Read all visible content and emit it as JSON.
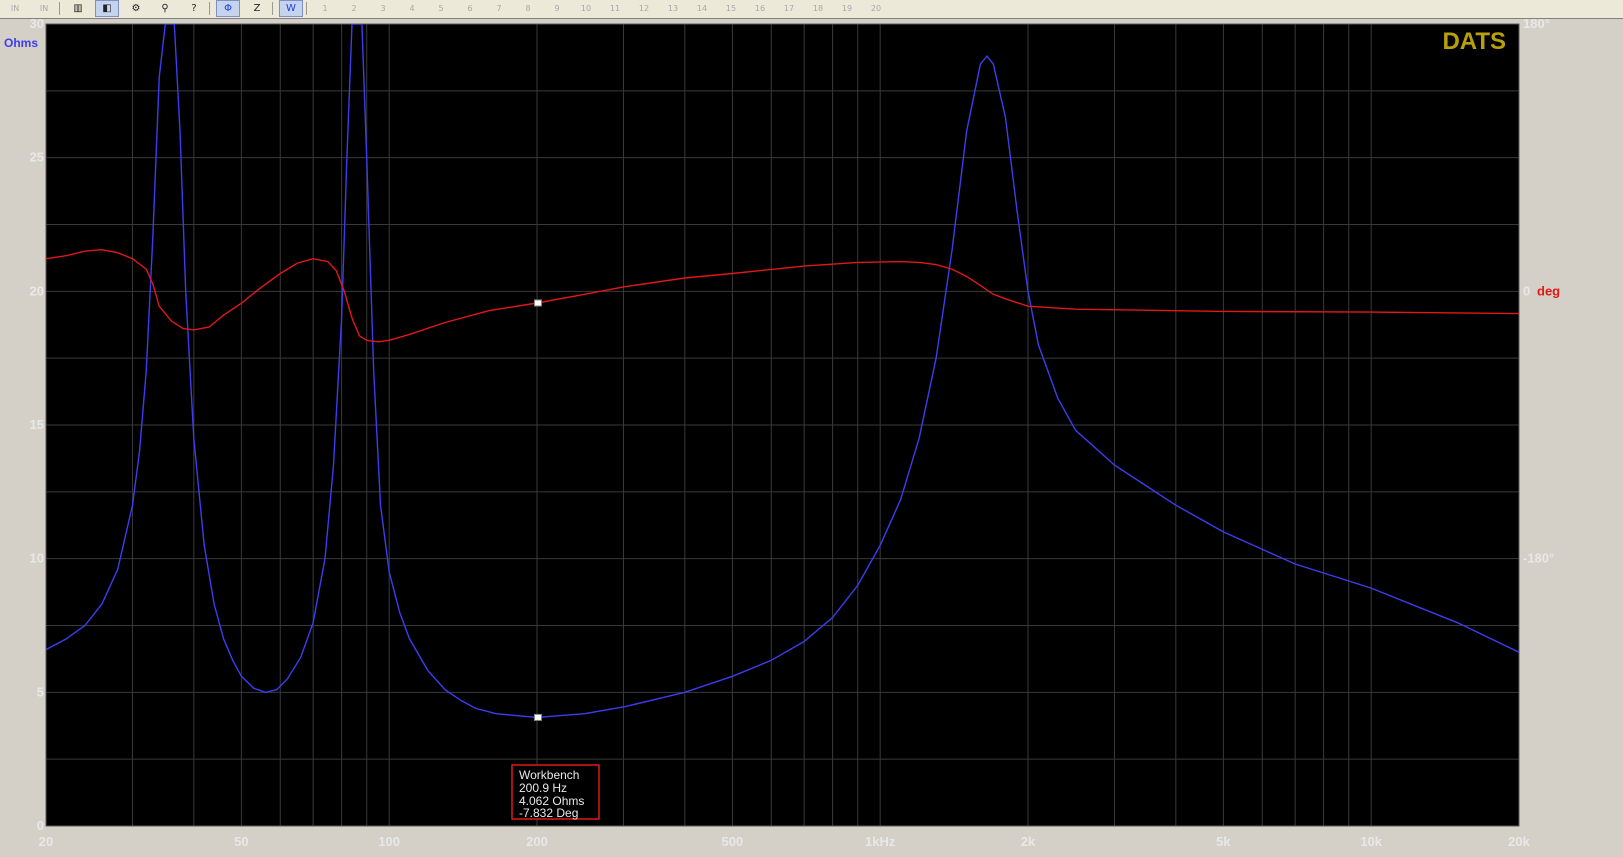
{
  "toolbar": {
    "buttons": [
      {
        "name": "mode-in-button",
        "glyph": "IN",
        "dim": true
      },
      {
        "name": "mode-out-button",
        "glyph": "IN",
        "dim": true
      },
      {
        "name": "measure-bars-button",
        "glyph": "▥"
      },
      {
        "name": "impedance-view-button",
        "glyph": "◧",
        "selected": true
      },
      {
        "name": "sweep-settings-button",
        "glyph": "⚙"
      },
      {
        "name": "probe-button",
        "glyph": "⚲"
      },
      {
        "name": "cursor-help-button",
        "glyph": "?"
      },
      {
        "name": "phase-button",
        "glyph": "Φ",
        "blue": true,
        "selected": true
      },
      {
        "name": "impedance-z-button",
        "glyph": "Z"
      },
      {
        "name": "workbench-button",
        "glyph": "W",
        "blue": true,
        "selected": true
      },
      {
        "name": "memory-1-button",
        "glyph": "1",
        "dim": true
      },
      {
        "name": "memory-2-button",
        "glyph": "2",
        "dim": true
      },
      {
        "name": "memory-3-button",
        "glyph": "3",
        "dim": true
      },
      {
        "name": "memory-4-button",
        "glyph": "4",
        "dim": true
      },
      {
        "name": "memory-5-button",
        "glyph": "5",
        "dim": true
      },
      {
        "name": "memory-6-button",
        "glyph": "6",
        "dim": true
      },
      {
        "name": "memory-7-button",
        "glyph": "7",
        "dim": true
      },
      {
        "name": "memory-8-button",
        "glyph": "8",
        "dim": true
      },
      {
        "name": "memory-9-button",
        "glyph": "9",
        "dim": true
      },
      {
        "name": "memory-10-button",
        "glyph": "10",
        "dim": true
      },
      {
        "name": "memory-11-button",
        "glyph": "11",
        "dim": true
      },
      {
        "name": "memory-12-button",
        "glyph": "12",
        "dim": true
      },
      {
        "name": "memory-13-button",
        "glyph": "13",
        "dim": true
      },
      {
        "name": "memory-14-button",
        "glyph": "14",
        "dim": true
      },
      {
        "name": "memory-15-button",
        "glyph": "15",
        "dim": true
      },
      {
        "name": "memory-16-button",
        "glyph": "16",
        "dim": true
      },
      {
        "name": "memory-17-button",
        "glyph": "17",
        "dim": true
      },
      {
        "name": "memory-18-button",
        "glyph": "18",
        "dim": true
      },
      {
        "name": "memory-19-button",
        "glyph": "19",
        "dim": true
      },
      {
        "name": "memory-20-button",
        "glyph": "20",
        "dim": true
      }
    ]
  },
  "chart_data": {
    "type": "line",
    "brand": "DATS",
    "y_unit_label": "Ohms",
    "x_scale": "log",
    "xlim": [
      20,
      20000
    ],
    "x_ticks": [
      {
        "v": 20,
        "label": "20"
      },
      {
        "v": 50,
        "label": "50"
      },
      {
        "v": 100,
        "label": "100"
      },
      {
        "v": 200,
        "label": "200"
      },
      {
        "v": 500,
        "label": "500"
      },
      {
        "v": 1000,
        "label": "1kHz"
      },
      {
        "v": 2000,
        "label": "2k"
      },
      {
        "v": 5000,
        "label": "5k"
      },
      {
        "v": 10000,
        "label": "10k"
      },
      {
        "v": 20000,
        "label": "20k"
      }
    ],
    "ylim": [
      0,
      30
    ],
    "y_ticks": [
      {
        "v": 0,
        "label": "0"
      },
      {
        "v": 5,
        "label": "5"
      },
      {
        "v": 10,
        "label": "10"
      },
      {
        "v": 15,
        "label": "15"
      },
      {
        "v": 20,
        "label": "20"
      },
      {
        "v": 25,
        "label": "25"
      },
      {
        "v": 30,
        "label": "30"
      }
    ],
    "y2lim": [
      -360,
      180
    ],
    "y2_ticks": [
      {
        "v": 180,
        "label": "180°"
      },
      {
        "v": 0,
        "label": "0",
        "unit": "deg"
      },
      {
        "v": -180,
        "label": "-180°"
      }
    ],
    "grid": true,
    "colors": {
      "background": "#000000",
      "grid": "#3a3a3a",
      "impedance": "#3d3df0",
      "phase": "#e01818",
      "brand": "#b8a00a",
      "marker_box": "#e01818"
    },
    "series": [
      {
        "key": "impedance",
        "axis": "left",
        "points": [
          [
            20,
            6.6
          ],
          [
            22,
            7.0
          ],
          [
            24,
            7.5
          ],
          [
            26,
            8.3
          ],
          [
            28,
            9.6
          ],
          [
            30,
            12.0
          ],
          [
            31,
            14.0
          ],
          [
            32,
            17.0
          ],
          [
            33,
            22.0
          ],
          [
            34,
            28.0
          ],
          [
            35,
            30.0
          ],
          [
            36.5,
            30.0
          ],
          [
            37.5,
            26.0
          ],
          [
            38.5,
            20.0
          ],
          [
            40,
            14.5
          ],
          [
            42,
            10.5
          ],
          [
            44,
            8.3
          ],
          [
            46,
            7.0
          ],
          [
            48,
            6.2
          ],
          [
            50,
            5.6
          ],
          [
            53,
            5.15
          ],
          [
            56,
            5.0
          ],
          [
            59,
            5.1
          ],
          [
            62,
            5.5
          ],
          [
            66,
            6.3
          ],
          [
            70,
            7.6
          ],
          [
            74,
            10.0
          ],
          [
            77,
            13.5
          ],
          [
            80,
            19.0
          ],
          [
            82,
            25.0
          ],
          [
            84,
            30.0
          ],
          [
            88,
            30.0
          ],
          [
            90,
            25.0
          ],
          [
            93,
            17.0
          ],
          [
            96,
            12.0
          ],
          [
            100,
            9.5
          ],
          [
            105,
            8.0
          ],
          [
            110,
            7.0
          ],
          [
            120,
            5.8
          ],
          [
            130,
            5.1
          ],
          [
            140,
            4.7
          ],
          [
            150,
            4.4
          ],
          [
            165,
            4.2
          ],
          [
            200,
            4.062
          ],
          [
            250,
            4.2
          ],
          [
            300,
            4.45
          ],
          [
            400,
            5.0
          ],
          [
            500,
            5.6
          ],
          [
            600,
            6.2
          ],
          [
            700,
            6.9
          ],
          [
            800,
            7.8
          ],
          [
            900,
            9.0
          ],
          [
            1000,
            10.5
          ],
          [
            1100,
            12.2
          ],
          [
            1200,
            14.5
          ],
          [
            1300,
            17.5
          ],
          [
            1400,
            21.5
          ],
          [
            1500,
            26.0
          ],
          [
            1600,
            28.5
          ],
          [
            1650,
            28.8
          ],
          [
            1700,
            28.5
          ],
          [
            1800,
            26.5
          ],
          [
            1900,
            23.0
          ],
          [
            2000,
            20.0
          ],
          [
            2100,
            18.0
          ],
          [
            2300,
            16.0
          ],
          [
            2500,
            14.8
          ],
          [
            3000,
            13.5
          ],
          [
            4000,
            12.0
          ],
          [
            5000,
            11.0
          ],
          [
            7000,
            9.8
          ],
          [
            10000,
            8.9
          ],
          [
            15000,
            7.6
          ],
          [
            20000,
            6.5
          ]
        ]
      },
      {
        "key": "phase",
        "axis": "right",
        "points": [
          [
            20,
            22
          ],
          [
            22,
            24
          ],
          [
            24,
            27
          ],
          [
            26,
            28
          ],
          [
            28,
            26
          ],
          [
            30,
            22
          ],
          [
            32,
            15
          ],
          [
            33,
            5
          ],
          [
            34,
            -10
          ],
          [
            36,
            -20
          ],
          [
            38,
            -25
          ],
          [
            40,
            -26
          ],
          [
            43,
            -24
          ],
          [
            46,
            -16
          ],
          [
            50,
            -8
          ],
          [
            55,
            3
          ],
          [
            60,
            12
          ],
          [
            65,
            19
          ],
          [
            70,
            22
          ],
          [
            75,
            20
          ],
          [
            78,
            14
          ],
          [
            81,
            0
          ],
          [
            84,
            -18
          ],
          [
            87,
            -30
          ],
          [
            90,
            -33
          ],
          [
            95,
            -34
          ],
          [
            100,
            -33
          ],
          [
            110,
            -29
          ],
          [
            130,
            -21
          ],
          [
            160,
            -13
          ],
          [
            200,
            -7.832
          ],
          [
            250,
            -2
          ],
          [
            300,
            3
          ],
          [
            400,
            9
          ],
          [
            500,
            12
          ],
          [
            700,
            17
          ],
          [
            900,
            19.5
          ],
          [
            1100,
            20
          ],
          [
            1200,
            19.5
          ],
          [
            1300,
            18
          ],
          [
            1400,
            15
          ],
          [
            1500,
            10
          ],
          [
            1600,
            4
          ],
          [
            1700,
            -2
          ],
          [
            1800,
            -5
          ],
          [
            2000,
            -10
          ],
          [
            2500,
            -12
          ],
          [
            5000,
            -13.5
          ],
          [
            10000,
            -14
          ],
          [
            20000,
            -15
          ]
        ]
      }
    ],
    "marker": {
      "title": "Workbench",
      "freq_hz": 200.9,
      "ohms": 4.062,
      "deg": -7.832,
      "lines": [
        "Workbench",
        "200.9 Hz",
        "4.062 Ohms",
        "-7.832 Deg"
      ]
    }
  }
}
